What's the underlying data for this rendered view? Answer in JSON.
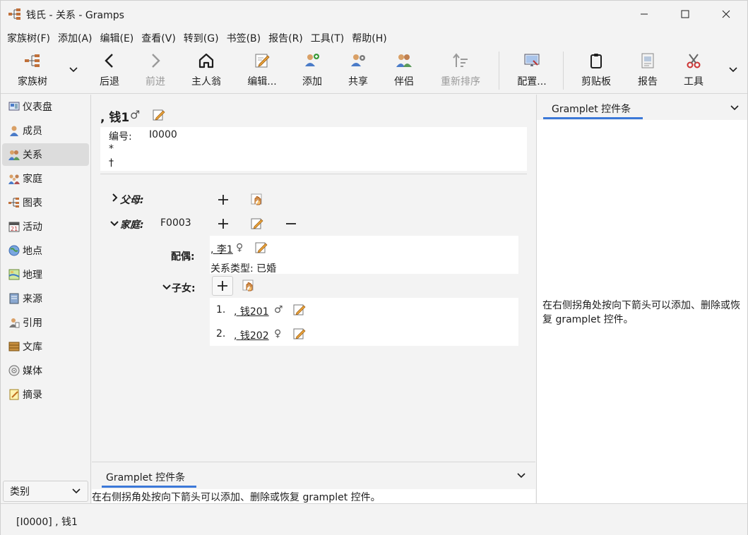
{
  "window": {
    "title": "钱氏 - 关系 - Gramps"
  },
  "menu": [
    "家族树(F)",
    "添加(A)",
    "编辑(E)",
    "查看(V)",
    "转到(G)",
    "书签(B)",
    "报告(R)",
    "工具(T)",
    "帮助(H)"
  ],
  "toolbar": {
    "family_tree": "家族树",
    "back": "后退",
    "forward": "前进",
    "home": "主人翁",
    "edit": "编辑...",
    "add": "添加",
    "share": "共享",
    "partner": "伴侣",
    "reorder": "重新排序",
    "configure": "配置...",
    "clipboard": "剪贴板",
    "reports": "报告",
    "tools": "工具"
  },
  "sidebar": {
    "items": [
      "仪表盘",
      "成员",
      "关系",
      "家庭",
      "图表",
      "活动",
      "地点",
      "地理",
      "来源",
      "引用",
      "文库",
      "媒体",
      "摘录"
    ],
    "active": "关系",
    "category": "类别"
  },
  "person": {
    "name": ", 钱1",
    "sex_symbol": "♂",
    "id_label": "编号:",
    "id_value": "I0000",
    "birth_symbol": "*",
    "death_symbol": "†"
  },
  "relations": {
    "parents_label": "父母:",
    "family_label": "家庭:",
    "family_id": "F0003",
    "spouse_label": "配偶:",
    "spouse_name": ", 李1",
    "spouse_sex": "♀",
    "relation_type": "关系类型: 已婚",
    "children_label": "子女:",
    "children": [
      {
        "num": "1.",
        "name": ", 钱201",
        "sex": "♂"
      },
      {
        "num": "2.",
        "name": ", 钱202",
        "sex": "♀"
      }
    ]
  },
  "gramplets": {
    "bottom_tab": "Gramplet 控件条",
    "bottom_text": "在右侧拐角处按向下箭头可以添加、删除或恢复 gramplet 控件。",
    "right_tab": "Gramplet 控件条",
    "right_text": "在右侧拐角处按向下箭头可以添加、删除或恢复 gramplet 控件。"
  },
  "status": {
    "text": "[I0000] , 钱1"
  },
  "colors": {
    "accent": "#3b78d8",
    "selection": "#dcdcdc"
  }
}
